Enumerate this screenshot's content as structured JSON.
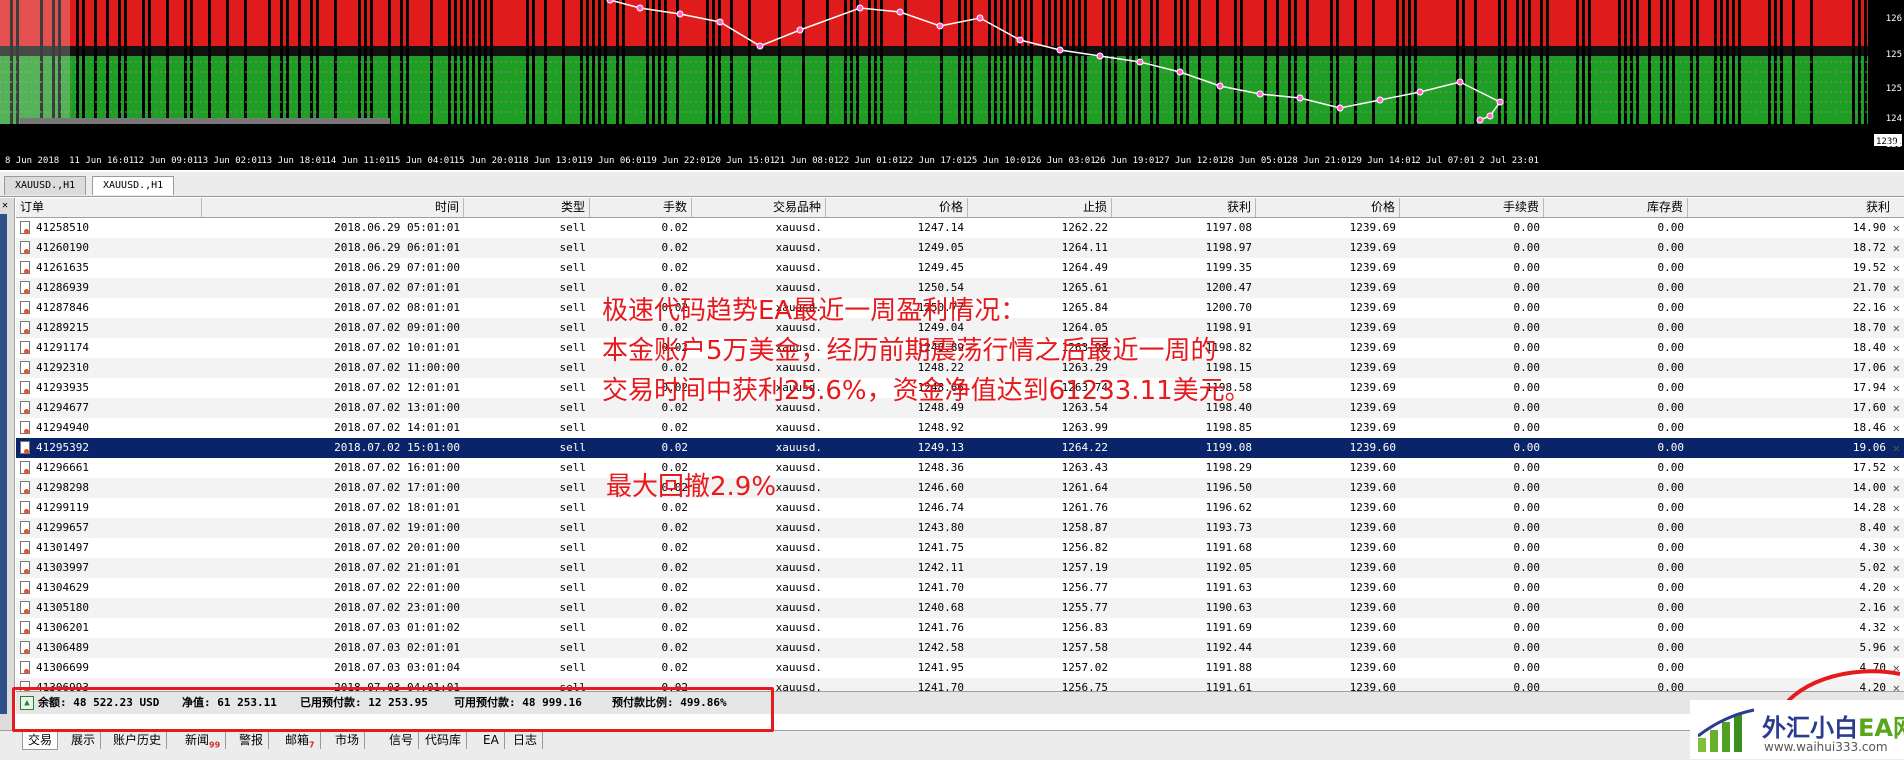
{
  "chart": {
    "time_labels": [
      "8 Jun 2018",
      "11 Jun 16:01",
      "12 Jun 09:01",
      "13 Jun 02:01",
      "13 Jun 18:01",
      "14 Jun 11:01",
      "15 Jun 04:01",
      "15 Jun 20:01",
      "18 Jun 13:01",
      "19 Jun 06:01",
      "19 Jun 22:01",
      "20 Jun 15:01",
      "21 Jun 08:01",
      "22 Jun 01:01",
      "22 Jun 17:01",
      "25 Jun 10:01",
      "26 Jun 03:01",
      "26 Jun 19:01",
      "27 Jun 12:01",
      "28 Jun 05:01",
      "28 Jun 21:01",
      "29 Jun 14:01",
      "2 Jul 07:01",
      "2 Jul 23:01"
    ],
    "price_labels": [
      "126",
      "125",
      "125",
      "124",
      "123"
    ],
    "current_price": "1239.6"
  },
  "chart_tabs": [
    "XAUUSD.,H1",
    "XAUUSD.,H1"
  ],
  "table": {
    "headers": {
      "order": "订单",
      "time": "时间",
      "type": "类型",
      "lots": "手数",
      "symbol": "交易品种",
      "price": "价格",
      "sl": "止损",
      "tp": "获利",
      "cur_price": "价格",
      "commission": "手续费",
      "swap": "库存费",
      "profit": "获利"
    },
    "rows": [
      [
        "41258510",
        "2018.06.29 05:01:01",
        "sell",
        "0.02",
        "xauusd.",
        "1247.14",
        "1262.22",
        "1197.08",
        "1239.69",
        "0.00",
        "0.00",
        "14.90"
      ],
      [
        "41260190",
        "2018.06.29 06:01:01",
        "sell",
        "0.02",
        "xauusd.",
        "1249.05",
        "1264.11",
        "1198.97",
        "1239.69",
        "0.00",
        "0.00",
        "18.72"
      ],
      [
        "41261635",
        "2018.06.29 07:01:00",
        "sell",
        "0.02",
        "xauusd.",
        "1249.45",
        "1264.49",
        "1199.35",
        "1239.69",
        "0.00",
        "0.00",
        "19.52"
      ],
      [
        "41286939",
        "2018.07.02 07:01:01",
        "sell",
        "0.02",
        "xauusd.",
        "1250.54",
        "1265.61",
        "1200.47",
        "1239.69",
        "0.00",
        "0.00",
        "21.70"
      ],
      [
        "41287846",
        "2018.07.02 08:01:01",
        "sell",
        "0.02",
        "xauusd.",
        "1250.77",
        "1265.84",
        "1200.70",
        "1239.69",
        "0.00",
        "0.00",
        "22.16"
      ],
      [
        "41289215",
        "2018.07.02 09:01:00",
        "sell",
        "0.02",
        "xauusd.",
        "1249.04",
        "1264.05",
        "1198.91",
        "1239.69",
        "0.00",
        "0.00",
        "18.70"
      ],
      [
        "41291174",
        "2018.07.02 10:01:01",
        "sell",
        "0.02",
        "xauusd.",
        "1248.89",
        "1263.98",
        "1198.82",
        "1239.69",
        "0.00",
        "0.00",
        "18.40"
      ],
      [
        "41292310",
        "2018.07.02 11:00:00",
        "sell",
        "0.02",
        "xauusd.",
        "1248.22",
        "1263.29",
        "1198.15",
        "1239.69",
        "0.00",
        "0.00",
        "17.06"
      ],
      [
        "41293935",
        "2018.07.02 12:01:01",
        "sell",
        "0.02",
        "xauusd.",
        "1248.66",
        "1263.74",
        "1198.58",
        "1239.69",
        "0.00",
        "0.00",
        "17.94"
      ],
      [
        "41294677",
        "2018.07.02 13:01:00",
        "sell",
        "0.02",
        "xauusd.",
        "1248.49",
        "1263.54",
        "1198.40",
        "1239.69",
        "0.00",
        "0.00",
        "17.60"
      ],
      [
        "41294940",
        "2018.07.02 14:01:01",
        "sell",
        "0.02",
        "xauusd.",
        "1248.92",
        "1263.99",
        "1198.85",
        "1239.69",
        "0.00",
        "0.00",
        "18.46"
      ],
      [
        "41295392",
        "2018.07.02 15:01:00",
        "sell",
        "0.02",
        "xauusd.",
        "1249.13",
        "1264.22",
        "1199.08",
        "1239.60",
        "0.00",
        "0.00",
        "19.06"
      ],
      [
        "41296661",
        "2018.07.02 16:01:00",
        "sell",
        "0.02",
        "xauusd.",
        "1248.36",
        "1263.43",
        "1198.29",
        "1239.60",
        "0.00",
        "0.00",
        "17.52"
      ],
      [
        "41298298",
        "2018.07.02 17:01:00",
        "sell",
        "0.02",
        "xauusd.",
        "1246.60",
        "1261.64",
        "1196.50",
        "1239.60",
        "0.00",
        "0.00",
        "14.00"
      ],
      [
        "41299119",
        "2018.07.02 18:01:01",
        "sell",
        "0.02",
        "xauusd.",
        "1246.74",
        "1261.76",
        "1196.62",
        "1239.60",
        "0.00",
        "0.00",
        "14.28"
      ],
      [
        "41299657",
        "2018.07.02 19:01:00",
        "sell",
        "0.02",
        "xauusd.",
        "1243.80",
        "1258.87",
        "1193.73",
        "1239.60",
        "0.00",
        "0.00",
        "8.40"
      ],
      [
        "41301497",
        "2018.07.02 20:01:00",
        "sell",
        "0.02",
        "xauusd.",
        "1241.75",
        "1256.82",
        "1191.68",
        "1239.60",
        "0.00",
        "0.00",
        "4.30"
      ],
      [
        "41303997",
        "2018.07.02 21:01:01",
        "sell",
        "0.02",
        "xauusd.",
        "1242.11",
        "1257.19",
        "1192.05",
        "1239.60",
        "0.00",
        "0.00",
        "5.02"
      ],
      [
        "41304629",
        "2018.07.02 22:01:00",
        "sell",
        "0.02",
        "xauusd.",
        "1241.70",
        "1256.77",
        "1191.63",
        "1239.60",
        "0.00",
        "0.00",
        "4.20"
      ],
      [
        "41305180",
        "2018.07.02 23:01:00",
        "sell",
        "0.02",
        "xauusd.",
        "1240.68",
        "1255.77",
        "1190.63",
        "1239.60",
        "0.00",
        "0.00",
        "2.16"
      ],
      [
        "41306201",
        "2018.07.03 01:01:02",
        "sell",
        "0.02",
        "xauusd.",
        "1241.76",
        "1256.83",
        "1191.69",
        "1239.60",
        "0.00",
        "0.00",
        "4.32"
      ],
      [
        "41306489",
        "2018.07.03 02:01:01",
        "sell",
        "0.02",
        "xauusd.",
        "1242.58",
        "1257.58",
        "1192.44",
        "1239.60",
        "0.00",
        "0.00",
        "5.96"
      ],
      [
        "41306699",
        "2018.07.03 03:01:04",
        "sell",
        "0.02",
        "xauusd.",
        "1241.95",
        "1257.02",
        "1191.88",
        "1239.60",
        "0.00",
        "0.00",
        "4.70"
      ],
      [
        "41306993",
        "2018.07.03 04:01:01",
        "sell",
        "0.02",
        "xauusd.",
        "1241.70",
        "1256.75",
        "1191.61",
        "1239.60",
        "0.00",
        "0.00",
        "4.20"
      ]
    ],
    "selected_row": 11
  },
  "status": {
    "balance": "余额: 48 522.23 USD",
    "equity": "净值: 61 253.11",
    "margin": "已用预付款: 12 253.95",
    "free_margin": "可用预付款: 48 999.16",
    "margin_level": "预付款比例: 499.86%"
  },
  "bottom_tabs": [
    {
      "label": "交易",
      "badge": ""
    },
    {
      "label": "展示",
      "badge": ""
    },
    {
      "label": "账户历史",
      "badge": ""
    },
    {
      "label": "新闻",
      "badge": "99"
    },
    {
      "label": "警报",
      "badge": ""
    },
    {
      "label": "邮箱",
      "badge": "7"
    },
    {
      "label": "市场",
      "badge": ""
    },
    {
      "label": "信号",
      "badge": ""
    },
    {
      "label": "代码库",
      "badge": ""
    },
    {
      "label": "EA",
      "badge": ""
    },
    {
      "label": "日志",
      "badge": ""
    }
  ],
  "annotation": {
    "line1": "极速代码趋势EA最近一周盈利情况：",
    "line2": "本金账户5万美金，经历前期震荡行情之后最近一周的",
    "line3": "交易时间中获利25.6%，资金净值达到61233.11美元。",
    "line4": "最大回撤2.9%"
  },
  "watermark": {
    "name_part1": "外汇小白",
    "name_part2": "EA网",
    "url": "www.waihui333.com"
  },
  "colors": {
    "red_zone": "#e01b1b",
    "green_zone": "#1e9e22",
    "selection": "#0a246a",
    "annotation": "#e8191c"
  }
}
